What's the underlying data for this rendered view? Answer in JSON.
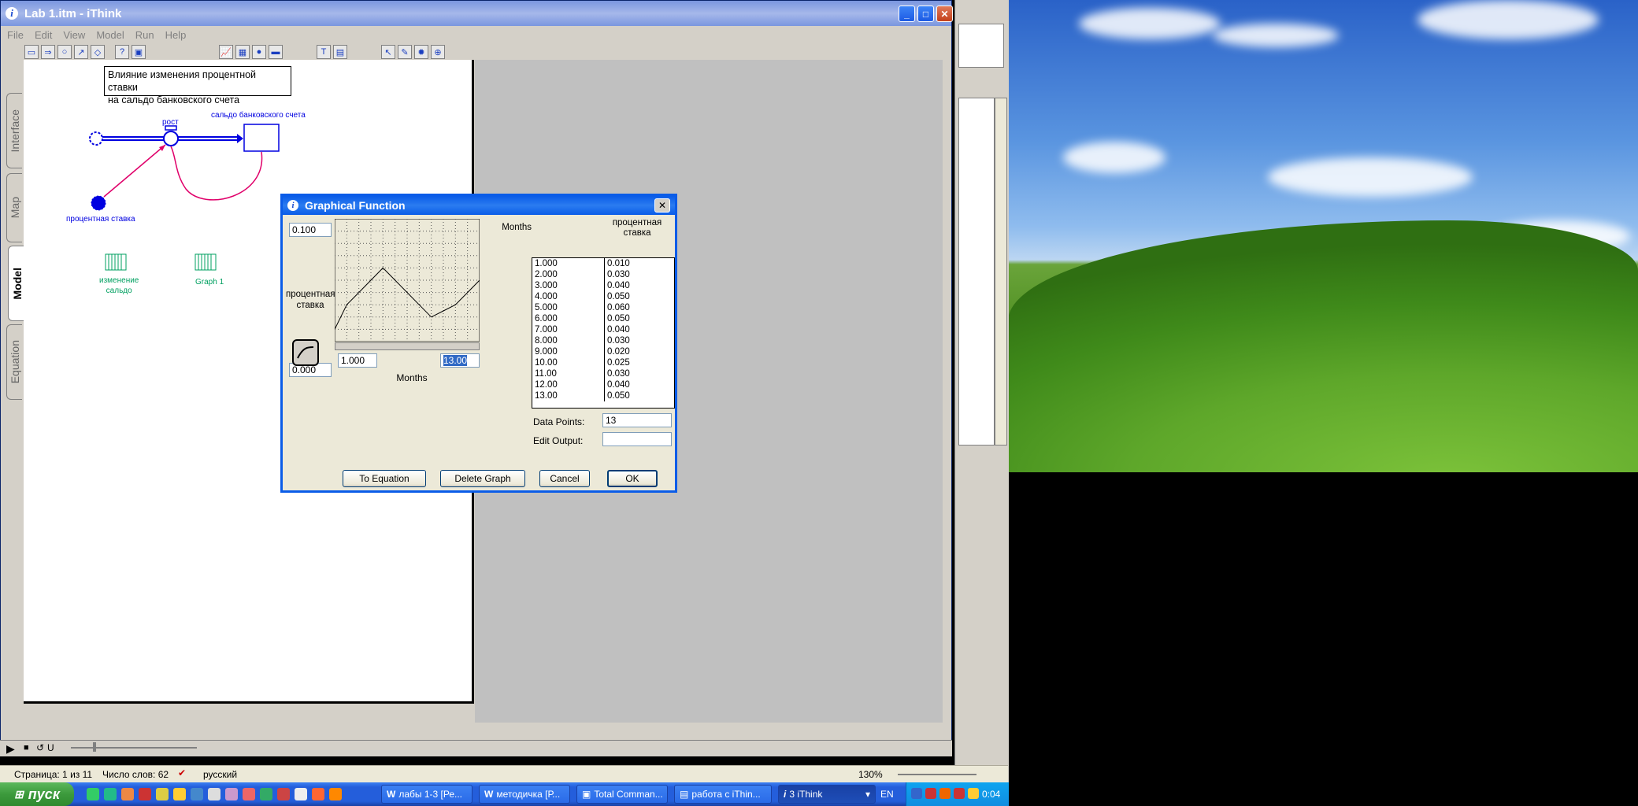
{
  "main_window": {
    "title": "Lab 1.itm - iThink",
    "menu": [
      "File",
      "Edit",
      "View",
      "Model",
      "Run",
      "Help"
    ]
  },
  "tabs": [
    "Interface",
    "Map",
    "Model",
    "Equation"
  ],
  "diagram": {
    "note": [
      "Влияние изменения процентной ставки",
      "на сальдо банковского счета"
    ],
    "flow_label": "рост",
    "stock_label": "сальдо банковского счета",
    "converter_label": "процентная ставка",
    "table_label": [
      "изменение",
      "сальдо"
    ],
    "graph_label": "Graph 1"
  },
  "dialog": {
    "title": "Graphical Function",
    "y_max": "0.100",
    "y_min": "0.000",
    "y_label": [
      "процентная",
      "ставка"
    ],
    "x_min": "1.000",
    "x_max": "13.00",
    "x_label": "Months",
    "col_input": "Months",
    "col_output": [
      "процентная",
      "ставка"
    ],
    "rows": [
      [
        "1.000",
        "0.010"
      ],
      [
        "2.000",
        "0.030"
      ],
      [
        "3.000",
        "0.040"
      ],
      [
        "4.000",
        "0.050"
      ],
      [
        "5.000",
        "0.060"
      ],
      [
        "6.000",
        "0.050"
      ],
      [
        "7.000",
        "0.040"
      ],
      [
        "8.000",
        "0.030"
      ],
      [
        "9.000",
        "0.020"
      ],
      [
        "10.00",
        "0.025"
      ],
      [
        "11.00",
        "0.030"
      ],
      [
        "12.00",
        "0.040"
      ],
      [
        "13.00",
        "0.050"
      ]
    ],
    "data_points_label": "Data Points:",
    "data_points_value": "13",
    "edit_output_label": "Edit Output:",
    "edit_output_value": "",
    "buttons": {
      "to_equation": "To Equation",
      "delete_graph": "Delete Graph",
      "cancel": "Cancel",
      "ok": "OK"
    }
  },
  "chart_data": {
    "type": "line",
    "x": [
      1,
      2,
      3,
      4,
      5,
      6,
      7,
      8,
      9,
      10,
      11,
      12,
      13
    ],
    "values": [
      0.01,
      0.03,
      0.04,
      0.05,
      0.06,
      0.05,
      0.04,
      0.03,
      0.02,
      0.025,
      0.03,
      0.04,
      0.05
    ],
    "xlim": [
      1,
      13
    ],
    "ylim": [
      0,
      0.1
    ],
    "xlabel": "Months",
    "ylabel": "процентная ставка",
    "grid": true
  },
  "statusbar": {
    "page": "Страница: 1 из 11",
    "words": "Число слов: 62",
    "language": "русский",
    "zoom": "130%"
  },
  "taskbar": {
    "start": "пуск",
    "tasks": [
      "лабы 1-3 [Ре...",
      "методичка [Р...",
      "Total Comman...",
      "работа с iThin...",
      "3 iThink"
    ],
    "lang": "EN",
    "clock": "0:04"
  }
}
